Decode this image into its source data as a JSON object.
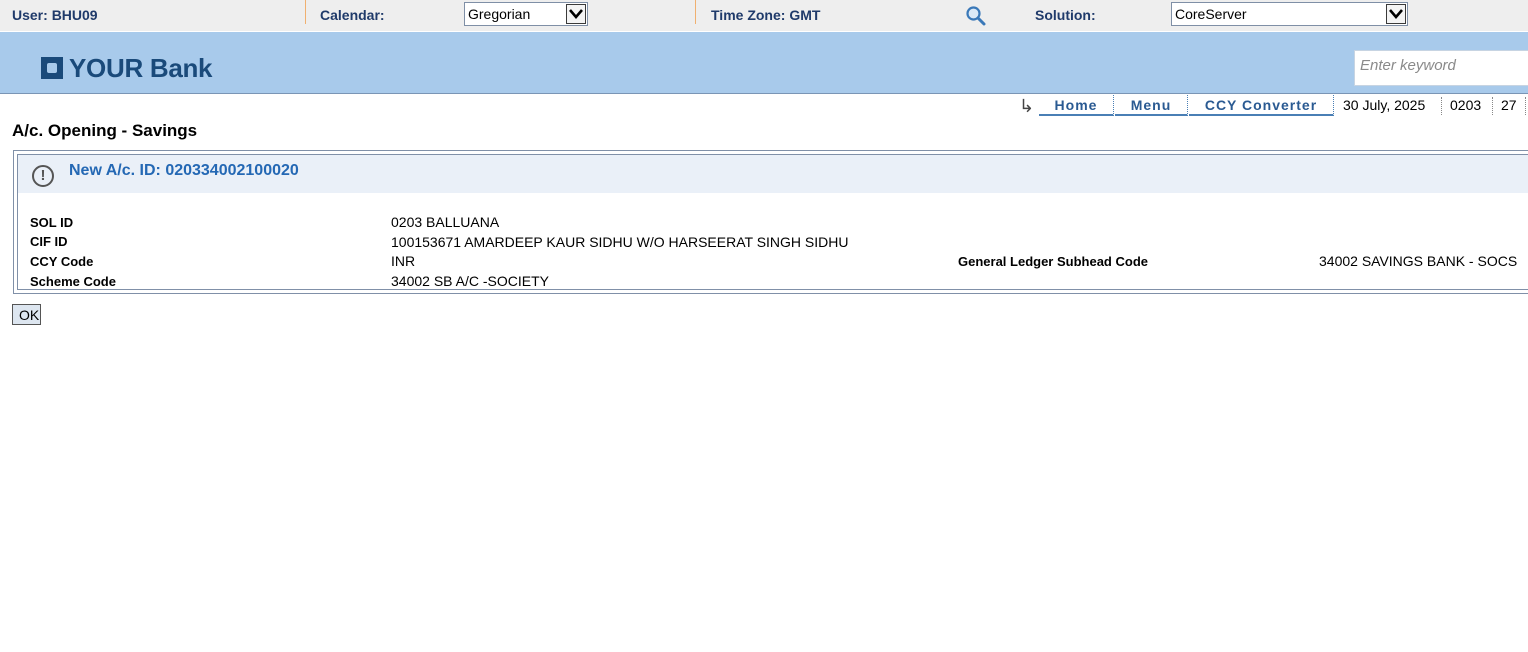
{
  "topbar": {
    "user_label": "User:",
    "user_value": "BHU09",
    "calendar_label": "Calendar:",
    "calendar_value": "Gregorian",
    "timezone_label": "Time Zone:",
    "timezone_value": "GMT",
    "solution_label": "Solution:",
    "solution_value": "CoreServer"
  },
  "banner": {
    "logo_text": "YOUR Bank",
    "search_placeholder": "Enter keyword"
  },
  "nav": {
    "tabs": [
      "Home",
      "Menu",
      "CCY Converter"
    ],
    "date": "30 July, 2025",
    "sol": "0203",
    "extra": "27"
  },
  "page": {
    "title": "A/c. Opening - Savings"
  },
  "panel": {
    "title": "New A/c. ID: 020334002100020",
    "fields": {
      "sol_id_label": "SOL ID",
      "sol_id_value": "0203 BALLUANA",
      "cif_id_label": "CIF ID",
      "cif_id_value": "100153671 AMARDEEP KAUR SIDHU W/O HARSEERAT SINGH SIDHU",
      "ccy_code_label": "CCY Code",
      "ccy_code_value": "INR",
      "gl_subhead_label": "General Ledger Subhead Code",
      "gl_subhead_value": "34002 SAVINGS BANK - SOCS",
      "scheme_code_label": "Scheme Code",
      "scheme_code_value": "34002 SB A/C -SOCIETY"
    }
  },
  "actions": {
    "ok_label": "OK"
  }
}
